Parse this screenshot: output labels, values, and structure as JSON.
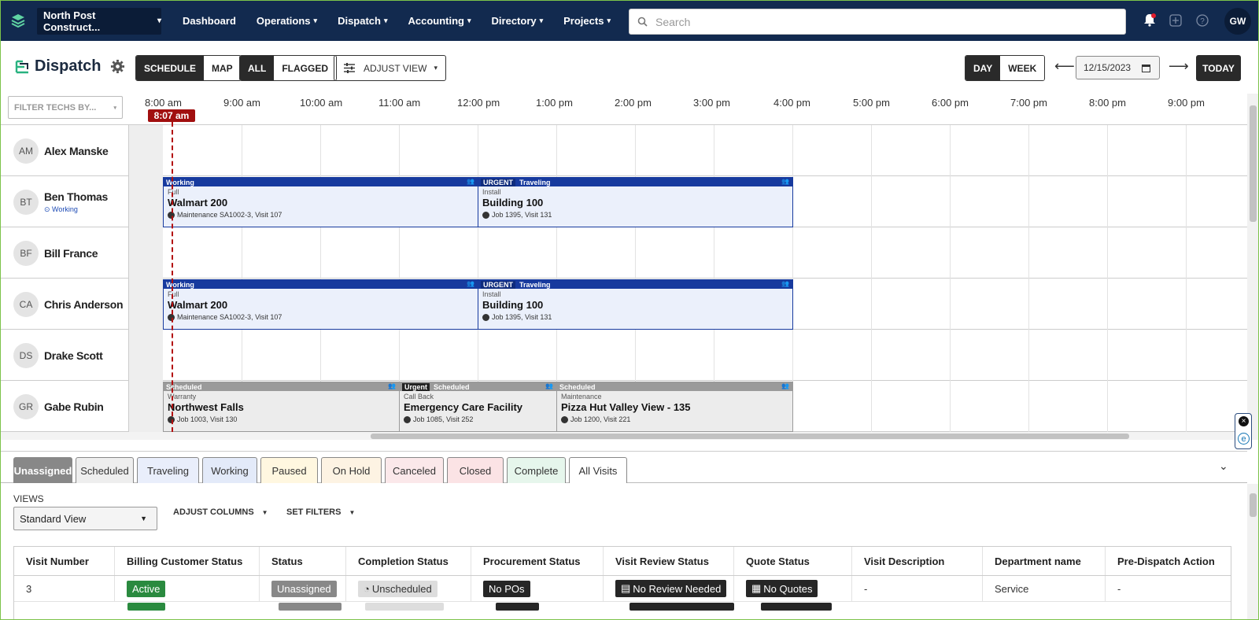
{
  "nav": {
    "company": "North Post Construct...",
    "items": [
      "Dashboard",
      "Operations",
      "Dispatch",
      "Accounting",
      "Directory",
      "Projects"
    ],
    "search_placeholder": "Search",
    "user_initials": "GW"
  },
  "toolbar": {
    "title": "Dispatch",
    "view_schedule": "SCHEDULE",
    "view_map": "MAP",
    "filter_all": "ALL",
    "filter_flagged": "FLAGGED",
    "adjust_view": "ADJUST VIEW",
    "day": "DAY",
    "week": "WEEK",
    "date": "12/15/2023",
    "today": "TODAY"
  },
  "schedule": {
    "filter_placeholder": "FILTER TECHS BY...",
    "hours": [
      "8:00 am",
      "9:00 am",
      "10:00 am",
      "11:00 am",
      "12:00 pm",
      "1:00 pm",
      "2:00 pm",
      "3:00 pm",
      "4:00 pm",
      "5:00 pm",
      "6:00 pm",
      "7:00 pm",
      "8:00 pm",
      "9:00 pm"
    ],
    "current_time": "8:07 am",
    "techs": [
      {
        "initials": "AM",
        "name": "Alex Manske",
        "status": ""
      },
      {
        "initials": "BT",
        "name": "Ben Thomas",
        "status": "Working"
      },
      {
        "initials": "BF",
        "name": "Bill France",
        "status": ""
      },
      {
        "initials": "CA",
        "name": "Chris Anderson",
        "status": ""
      },
      {
        "initials": "DS",
        "name": "Drake Scott",
        "status": ""
      },
      {
        "initials": "GR",
        "name": "Gabe Rubin",
        "status": ""
      }
    ],
    "cards": {
      "bt1": {
        "status": "Working",
        "type": "Full",
        "title": "Walmart 200",
        "sub": "Maintenance SA1002-3, Visit 107"
      },
      "bt2": {
        "tag": "URGENT",
        "status": "Traveling",
        "type": "Install",
        "title": "Building 100",
        "sub": "Job 1395, Visit 131"
      },
      "ca1": {
        "status": "Working",
        "type": "Full",
        "title": "Walmart 200",
        "sub": "Maintenance SA1002-3, Visit 107"
      },
      "ca2": {
        "tag": "URGENT",
        "status": "Traveling",
        "type": "Install",
        "title": "Building 100",
        "sub": "Job 1395, Visit 131"
      },
      "gr1": {
        "status": "Scheduled",
        "type": "Warranty",
        "title": "Northwest Falls",
        "sub": "Job 1003, Visit 130"
      },
      "gr2": {
        "tag": "Urgent",
        "status": "Scheduled",
        "type": "Call Back",
        "title": "Emergency Care Facility",
        "sub": "Job 1085, Visit 252"
      },
      "gr3": {
        "status": "Scheduled",
        "type": "Maintenance",
        "title": "Pizza Hut Valley View - 135",
        "sub": "Job 1200, Visit 221"
      }
    }
  },
  "tabs": [
    "Unassigned",
    "Scheduled",
    "Traveling",
    "Working",
    "Paused",
    "On Hold",
    "Canceled",
    "Closed",
    "Complete",
    "All Visits"
  ],
  "colors": {
    "nav": "#122a4f",
    "working": "#173a9e",
    "scheduled": "#9a9a9a",
    "now": "#a10f0f",
    "active_green": "#2a8a3f"
  },
  "views": {
    "label": "VIEWS",
    "selected": "Standard View",
    "adjust_columns": "ADJUST COLUMNS",
    "set_filters": "SET FILTERS"
  },
  "table": {
    "headers": [
      "Visit Number",
      "Billing Customer Status",
      "Status",
      "Completion Status",
      "Procurement Status",
      "Visit Review Status",
      "Quote Status",
      "Visit Description",
      "Department name",
      "Pre-Dispatch Action"
    ],
    "row": [
      "3",
      "Active",
      "Unassigned",
      "Unscheduled",
      "No POs",
      "No Review Needed",
      "No Quotes",
      "-",
      "Service",
      "-"
    ]
  }
}
